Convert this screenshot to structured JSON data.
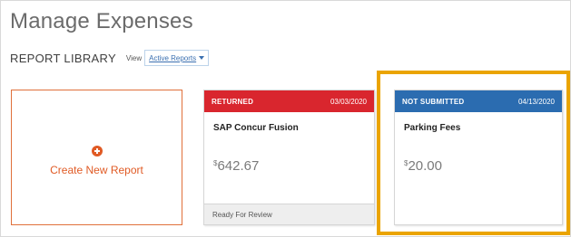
{
  "page": {
    "title": "Manage Expenses"
  },
  "library": {
    "title": "REPORT LIBRARY",
    "view_label": "View",
    "view_value": "Active Reports"
  },
  "create": {
    "label": "Create New Report",
    "icon": "plus-circle-icon"
  },
  "reports": [
    {
      "status": "RETURNED",
      "date": "03/03/2020",
      "name": "SAP Concur Fusion",
      "currency": "$",
      "amount": "642.67",
      "footer": "Ready For Review",
      "status_color": "#d9262e"
    },
    {
      "status": "NOT SUBMITTED",
      "date": "04/13/2020",
      "name": "Parking Fees",
      "currency": "$",
      "amount": "20.00",
      "footer": "",
      "status_color": "#2b6cb0"
    }
  ],
  "colors": {
    "accent": "#e05a24",
    "highlight": "#eaa400",
    "link": "#3a6fb0"
  }
}
